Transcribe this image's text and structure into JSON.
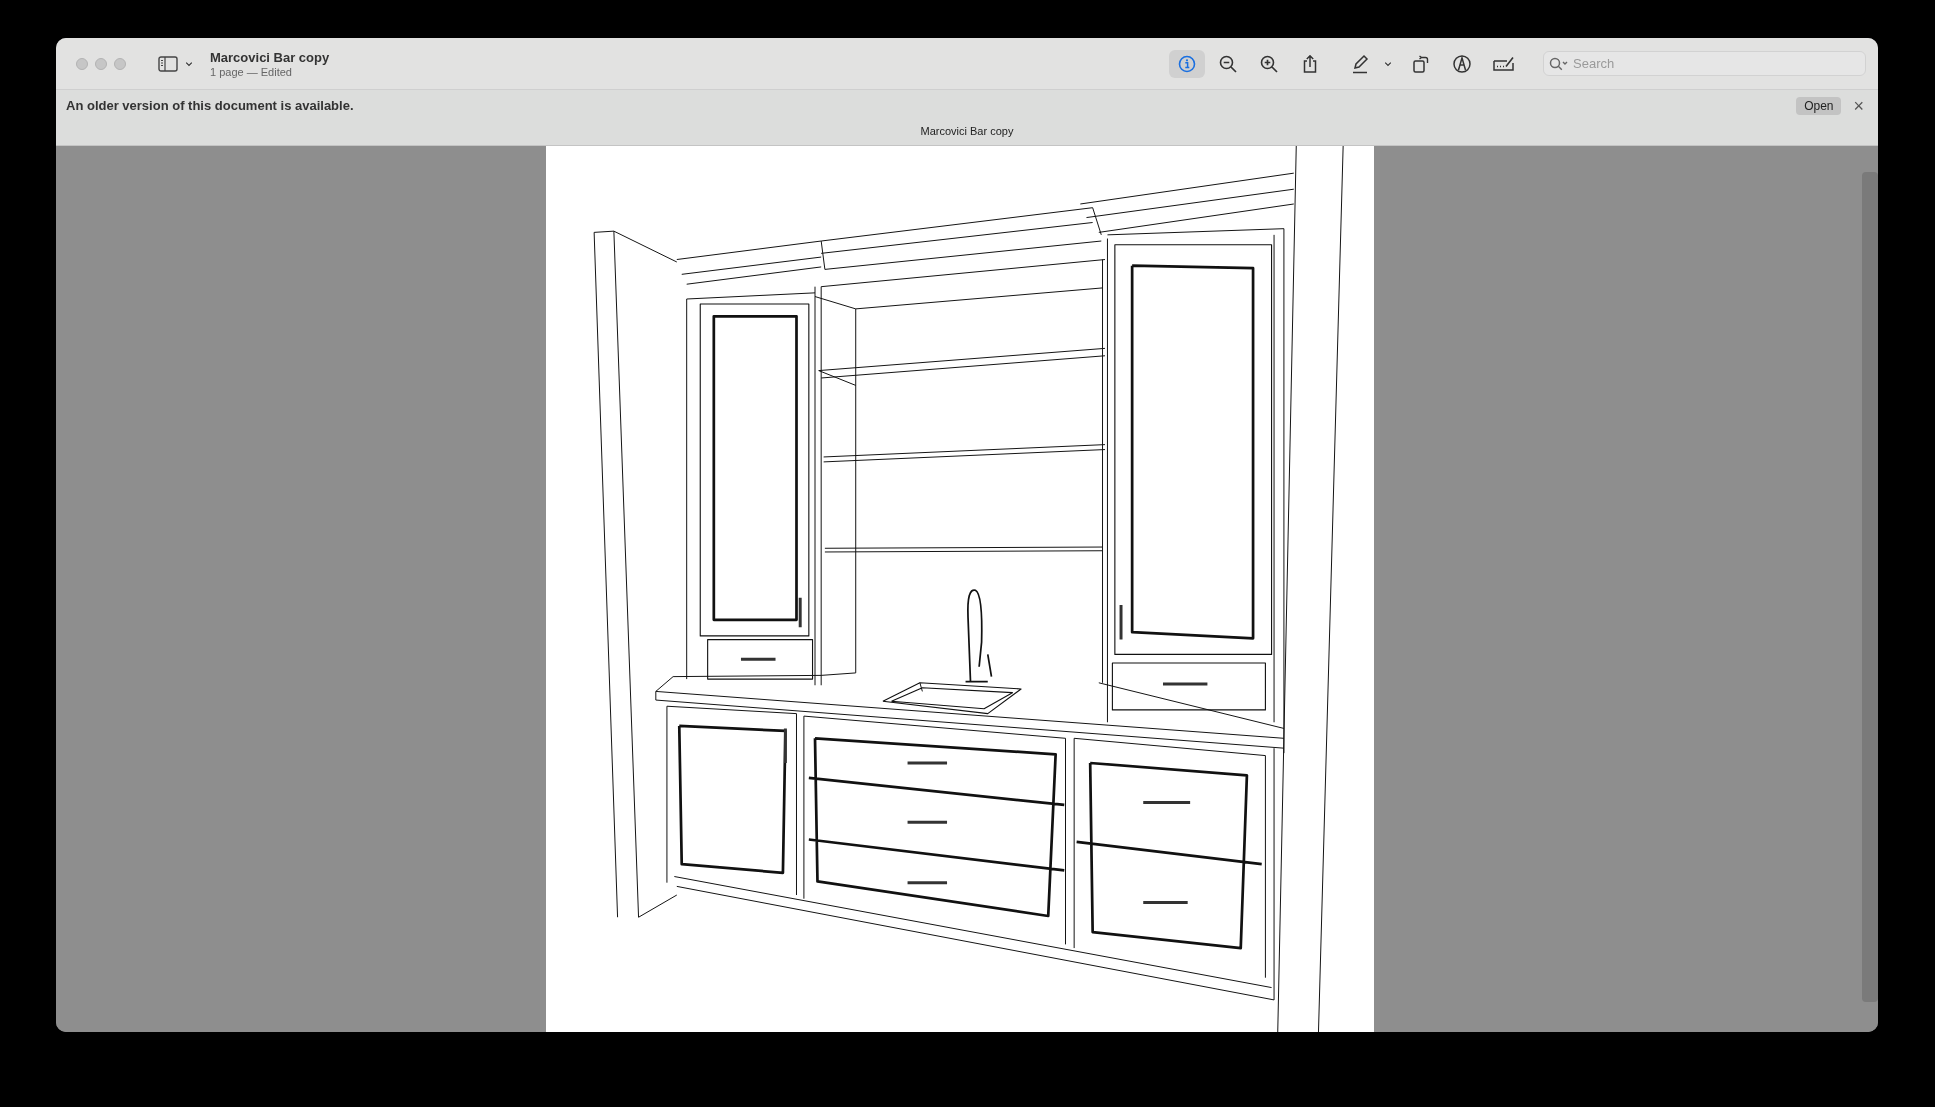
{
  "window": {
    "title": "Marcovici Bar copy",
    "subtitle": "1 page — Edited"
  },
  "toolbar": {
    "buttons": [
      {
        "kind": "info",
        "selected": true
      },
      {
        "kind": "zoom-out",
        "selected": false
      },
      {
        "kind": "zoom-in",
        "selected": false
      },
      {
        "kind": "share",
        "selected": false
      },
      {
        "kind": "pen",
        "selected": false
      },
      {
        "kind": "chevron",
        "selected": false
      },
      {
        "kind": "rotate",
        "selected": false
      },
      {
        "kind": "markup",
        "selected": false
      },
      {
        "kind": "form",
        "selected": false
      }
    ],
    "search": {
      "placeholder": "Search"
    }
  },
  "banner": {
    "message": "An older version of this document is available.",
    "open_button": "Open",
    "close_button": "×",
    "document_title": "Marcovici Bar copy"
  }
}
